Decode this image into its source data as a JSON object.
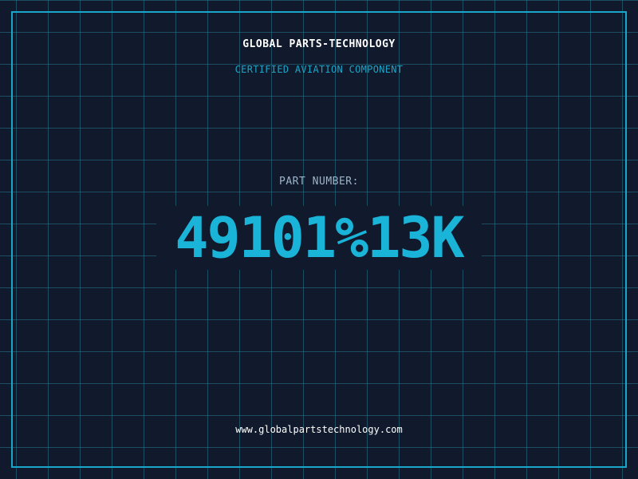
{
  "header": {
    "company": "GLOBAL PARTS-TECHNOLOGY",
    "subtitle": "CERTIFIED AVIATION COMPONENT"
  },
  "part": {
    "label": "PART NUMBER:",
    "number": "49101%13K"
  },
  "footer": {
    "website": "www.globalpartstechnology.com"
  },
  "colors": {
    "background": "#101a2c",
    "grid": "#28788c",
    "frame": "#1aa6c8",
    "accent": "#1ab4d8",
    "label": "#9fb3c8",
    "text": "#ffffff"
  }
}
